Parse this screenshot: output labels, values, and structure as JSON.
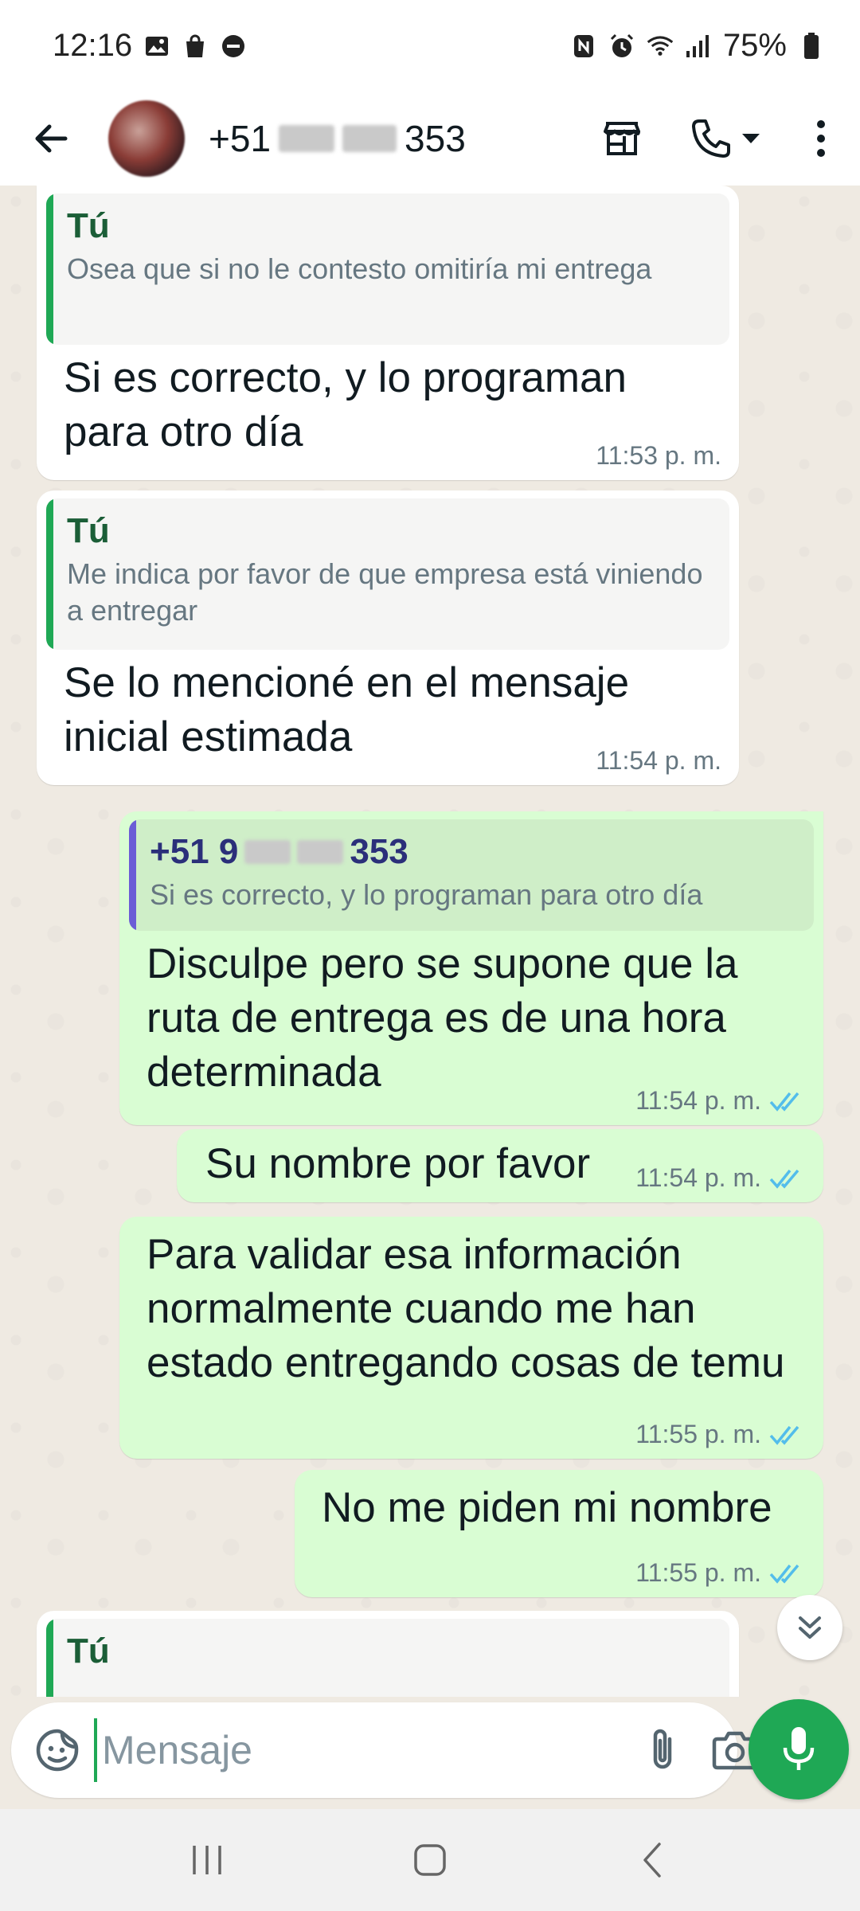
{
  "status_bar": {
    "time": "12:16",
    "battery": "75%"
  },
  "header": {
    "contact_prefix": "+51",
    "contact_suffix": "353",
    "icons": [
      "back-arrow-icon",
      "store-icon",
      "phone-icon",
      "chevron-down-icon",
      "more-vert-icon"
    ]
  },
  "messages": [
    {
      "direction": "in",
      "quote_author": "Tú",
      "quote_text": "Osea que si no le contesto omitiría mi entrega",
      "body": "Si es correcto, y lo programan para otro día",
      "time": "11:53 p. m."
    },
    {
      "direction": "in",
      "quote_author": "Tú",
      "quote_text": "Me indica por favor de que empresa está viniendo a entregar",
      "body": "Se lo mencioné en el mensaje inicial estimada",
      "time": "11:54 p. m."
    },
    {
      "direction": "out",
      "quote_author_prefix": "+51 9",
      "quote_author_suffix": "353",
      "quote_text": "Si es correcto, y lo programan para otro día",
      "body": "Disculpe pero se supone que la ruta de entrega es de una hora determinada",
      "time": "11:54 p. m.",
      "status": "read"
    },
    {
      "direction": "out",
      "body": "Su nombre por favor",
      "time": "11:54 p. m.",
      "status": "read"
    },
    {
      "direction": "out",
      "body": "Para validar esa información normalmente cuando me han estado entregando cosas de temu",
      "time": "11:55 p. m.",
      "status": "read"
    },
    {
      "direction": "out",
      "body": "No me piden mi nombre",
      "time": "11:55 p. m.",
      "status": "read"
    },
    {
      "direction": "in",
      "quote_author": "Tú"
    }
  ],
  "composer": {
    "placeholder": "Mensaje"
  },
  "colors": {
    "accent": "#1fa855",
    "outgoing_bubble": "#d9fdd3",
    "incoming_bubble": "#ffffff",
    "chat_bg": "#efeae2",
    "read_ticks": "#53bdeb"
  }
}
